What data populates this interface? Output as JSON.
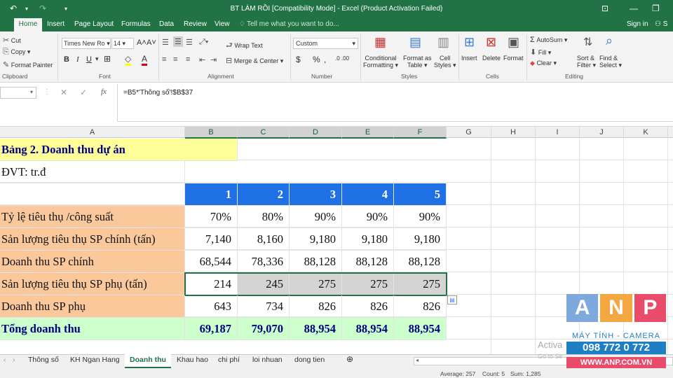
{
  "window": {
    "title": "BT LÀM RỒI  [Compatibility Mode] - Excel (Product Activation Failed)",
    "undo_icon": "undo-icon",
    "redo_icon": "redo-icon"
  },
  "tabs": [
    "Home",
    "Insert",
    "Page Layout",
    "Formulas",
    "Data",
    "Review",
    "View"
  ],
  "tell_me": "Tell me what you want to do...",
  "sign_in": "Sign in",
  "share": "S",
  "ribbon": {
    "clipboard": {
      "cut": "Cut",
      "copy": "Copy",
      "format_painter": "Format Painter",
      "group": "Clipboard"
    },
    "font": {
      "name": "Times New Ro",
      "size": "14",
      "bold": "B",
      "italic": "I",
      "underline": "U",
      "group": "Font"
    },
    "alignment": {
      "wrap": "Wrap Text",
      "merge": "Merge & Center",
      "group": "Alignment"
    },
    "number": {
      "format": "Custom",
      "currency": "$",
      "percent": "%",
      "comma": ",",
      "inc": ".0  .00",
      "group": "Number"
    },
    "styles": {
      "conditional": "Conditional",
      "conditional2": "Formatting",
      "format_table": "Format as",
      "format_table2": "Table",
      "cell_styles": "Cell",
      "cell_styles2": "Styles",
      "group": "Styles"
    },
    "cells": {
      "insert": "Insert",
      "delete": "Delete",
      "format": "Format",
      "group": "Cells"
    },
    "editing": {
      "autosum": "AutoSum",
      "fill": "Fill",
      "clear": "Clear",
      "sort": "Sort &",
      "sort2": "Filter",
      "find": "Find &",
      "find2": "Select",
      "group": "Editing"
    }
  },
  "formula": {
    "fx": "fx",
    "value": "=B5*'Thông số'!$B$37"
  },
  "columns": [
    "A",
    "B",
    "C",
    "D",
    "E",
    "F",
    "G",
    "H",
    "I",
    "J",
    "K"
  ],
  "rows": {
    "title": "Bảng 2. Doanh thu dự án",
    "unit": "ĐVT: tr.đ",
    "years": [
      "1",
      "2",
      "3",
      "4",
      "5"
    ],
    "data": [
      {
        "label": "Tỷ lệ tiêu thụ /công suất",
        "values": [
          "70%",
          "80%",
          "90%",
          "90%",
          "90%"
        ]
      },
      {
        "label": "Sản lượng tiêu thụ SP chính (tấn)",
        "values": [
          "7,140",
          "8,160",
          "9,180",
          "9,180",
          "9,180"
        ]
      },
      {
        "label": "Doanh thu SP chính",
        "values": [
          "68,544",
          "78,336",
          "88,128",
          "88,128",
          "88,128"
        ]
      },
      {
        "label": "Sản lượng tiêu thụ SP phụ (tấn)",
        "values": [
          "214",
          "245",
          "275",
          "275",
          "275"
        ]
      },
      {
        "label": "Doanh thu SP phụ",
        "values": [
          "643",
          "734",
          "826",
          "826",
          "826"
        ]
      }
    ],
    "total": {
      "label": "Tổng doanh thu",
      "values": [
        "69,187",
        "79,070",
        "88,954",
        "88,954",
        "88,954"
      ]
    }
  },
  "sheets": [
    "Thông số",
    "KH Ngan Hang",
    "Doanh thu",
    "Khau hao",
    "chi phí",
    "loi nhuan",
    "dong tien"
  ],
  "active_sheet": "Doanh thu",
  "status": {
    "average": "Average: 257",
    "count": "Count: 5",
    "sum": "Sum: 1,285"
  },
  "watermark": {
    "brand": "ANP",
    "tagline": "MÁY TÍNH - CAMERA",
    "phone": "098 772 0 772",
    "web": "WWW.ANP.COM.VN",
    "activate": "Activa",
    "activate2": "Go to Se"
  },
  "colors": {
    "excel_green": "#217346",
    "yellow": "#ffff99",
    "orange": "#fbc89b",
    "blue_header": "#1f6fe5",
    "green_total": "#ccffcc",
    "navy_text": "#000080"
  }
}
